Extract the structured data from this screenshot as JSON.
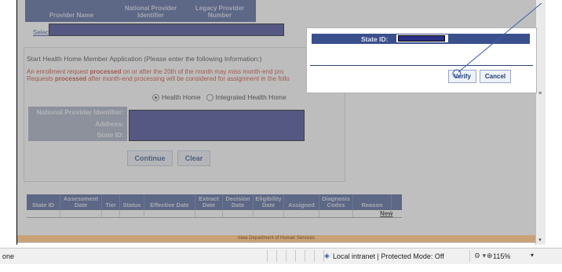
{
  "page_header": {
    "columns": [
      "Provider Name",
      "National Provider Identifier",
      "Legacy Provider Number"
    ]
  },
  "select_link": "Select",
  "form": {
    "title": "Start Health Home Member Application (Please enter the following Information:)",
    "warning_line1_pre": "An enrollment request ",
    "warning_line1_bold": "processed",
    "warning_line1_post": " on or after the 20th of the month may miss month-end pro",
    "warning_line2_pre": "Requests ",
    "warning_line2_bold": "processed",
    "warning_line2_post": " after month-end processing will be considered for assignment in the follo",
    "radio_health_home": "Health Home",
    "radio_integrated": "Integrated Health Home",
    "field_npi": "National Provider Identifier:",
    "field_address": "Address:",
    "field_state_id": "State ID:",
    "continue_label": "Continue",
    "clear_label": "Clear"
  },
  "grid": {
    "headers": [
      "State ID",
      "Assessment Date",
      "Tier",
      "Status",
      "Effective Date",
      "Extract Date",
      "Decision Date",
      "Eligibility Date",
      "Assigned",
      "Diagnosis Codes",
      "Reason"
    ],
    "new_link": "New"
  },
  "footer": "Iowa Department of Human Services",
  "dialog": {
    "state_id_label": "State ID:",
    "verify_label": "Verify",
    "cancel_label": "Cancel"
  },
  "statusbar": {
    "left_text": "one",
    "zone_text": "Local intranet | Protected Mode: Off",
    "zoom_text": "115%"
  },
  "colors": {
    "header_blue": "#3a4f8c",
    "redaction": "#2b3185",
    "warning_red": "#c2331d",
    "footer_tan": "#c9a277"
  }
}
